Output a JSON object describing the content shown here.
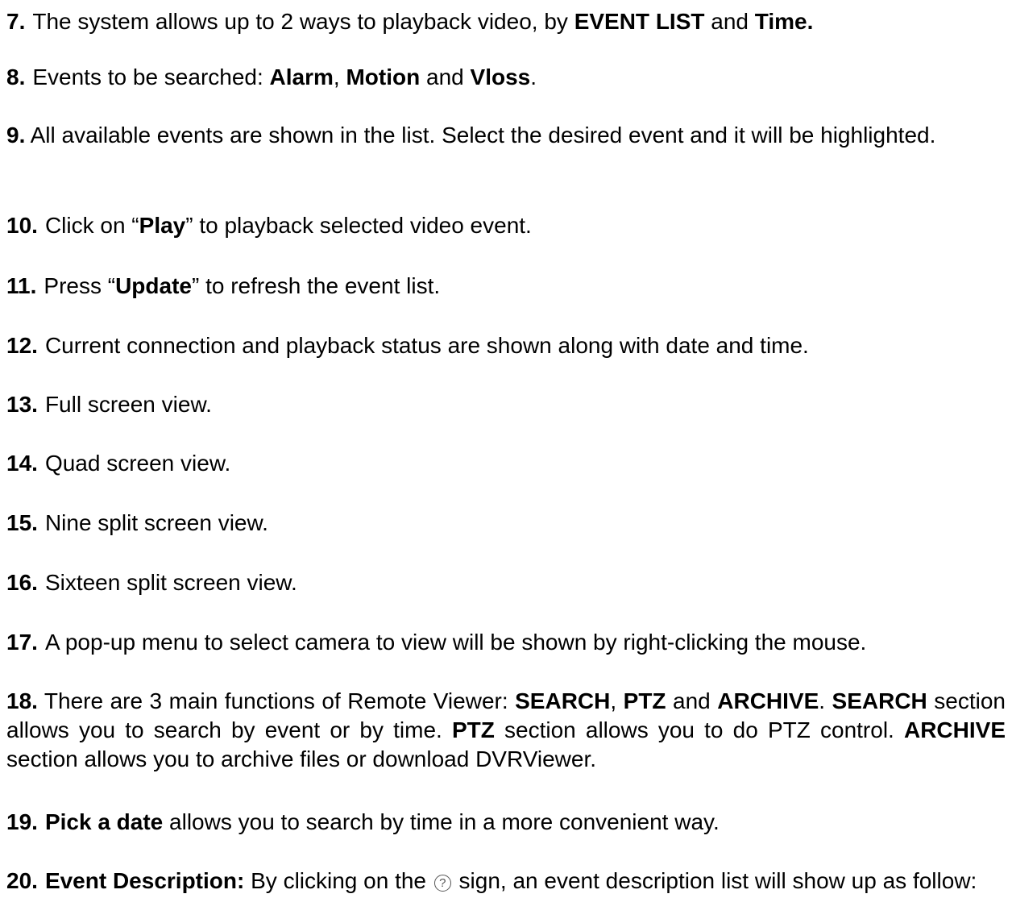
{
  "items": [
    {
      "num": "7.",
      "parts": [
        "The system allows up to 2 ways to playback video, by ",
        "EVENT LIST",
        " and ",
        "Time."
      ]
    },
    {
      "num": "8.",
      "parts": [
        "Events to be searched: ",
        "Alarm",
        ", ",
        "Motion",
        " and ",
        "Vloss",
        "."
      ]
    },
    {
      "num": "9.",
      "parts": [
        " All available events are shown in the list. Select the desired event and it will be highlighted."
      ]
    },
    {
      "num": "10.",
      "parts": [
        "Click on “",
        "Play",
        "” to playback selected video event."
      ]
    },
    {
      "num": "11.",
      "parts": [
        "Press “",
        "Update",
        "” to refresh the event list."
      ]
    },
    {
      "num": "12.",
      "parts": [
        "Current connection and playback status are shown along with date and time."
      ]
    },
    {
      "num": "13.",
      "parts": [
        "Full screen view."
      ]
    },
    {
      "num": "14.",
      "parts": [
        "Quad screen view."
      ]
    },
    {
      "num": "15.",
      "parts": [
        "Nine split screen view."
      ]
    },
    {
      "num": "16.",
      "parts": [
        "Sixteen split screen view."
      ]
    },
    {
      "num": "17.",
      "parts": [
        "A pop-up menu to select camera to view will be shown by right-clicking the mouse."
      ]
    },
    {
      "num": "18.",
      "parts": [
        " There are 3 main functions of Remote Viewer: ",
        "SEARCH",
        ", ",
        "PTZ",
        " and ",
        "ARCHIVE",
        ". ",
        "SEARCH",
        " section allows you to search by event or by time. ",
        "PTZ",
        " section allows you to do PTZ control. ",
        "ARCHIVE",
        " section allows you to archive files or download DVRViewer."
      ]
    },
    {
      "num": "19.",
      "parts": [
        "Pick a date",
        " allows you to search by time in a more convenient way."
      ]
    },
    {
      "num": "20.",
      "parts": [
        "Event Description:",
        " By clicking on the ",
        "?",
        " sign, an event description list will show up as follow:"
      ]
    }
  ]
}
